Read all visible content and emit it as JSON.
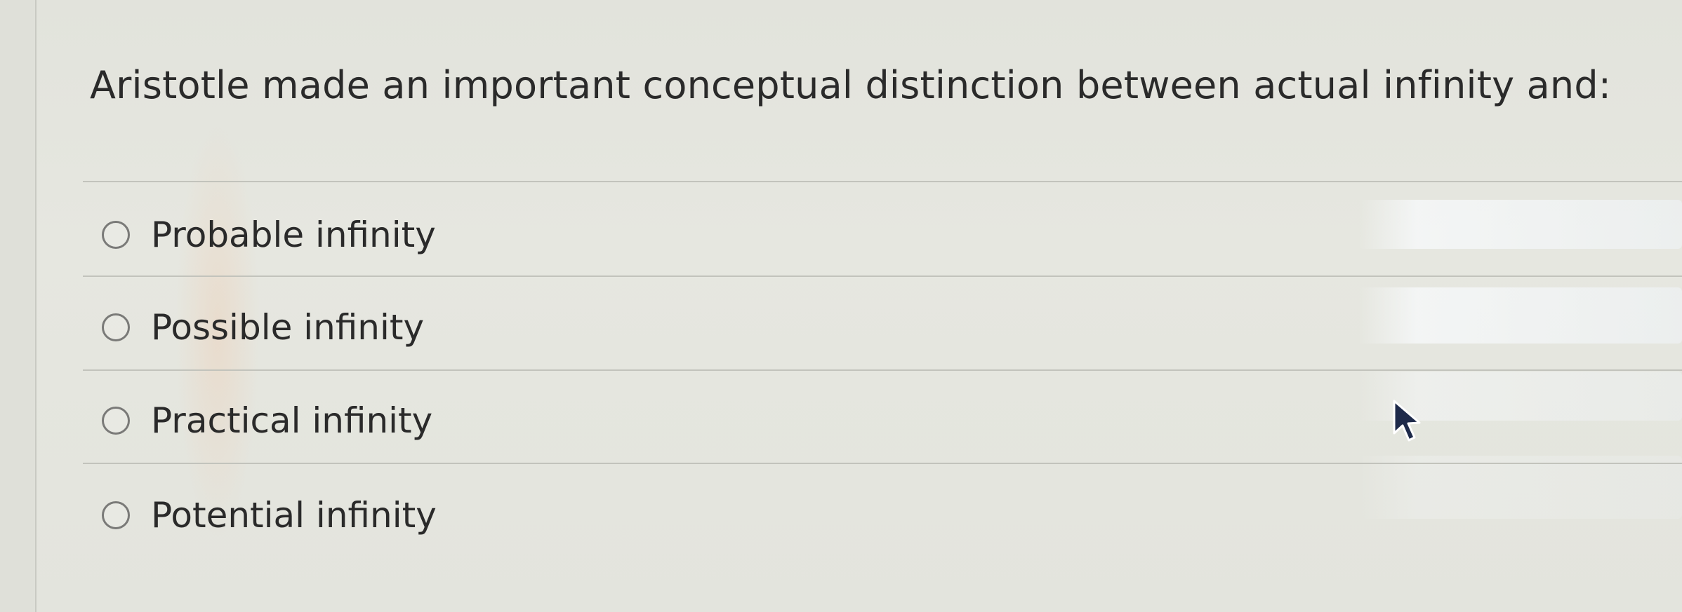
{
  "question": {
    "text": "Aristotle made an important conceptual distinction between actual infinity and:"
  },
  "options": [
    {
      "label": "Probable infinity"
    },
    {
      "label": "Possible infinity"
    },
    {
      "label": "Practical infinity"
    },
    {
      "label": "Potential infinity"
    }
  ],
  "colors": {
    "background": "#e4e4dd",
    "text": "#2a2a2a",
    "radio_border": "#7a7a78",
    "divider": "#c2c3bc"
  },
  "icons": {
    "cursor": "mouse-pointer-icon"
  }
}
